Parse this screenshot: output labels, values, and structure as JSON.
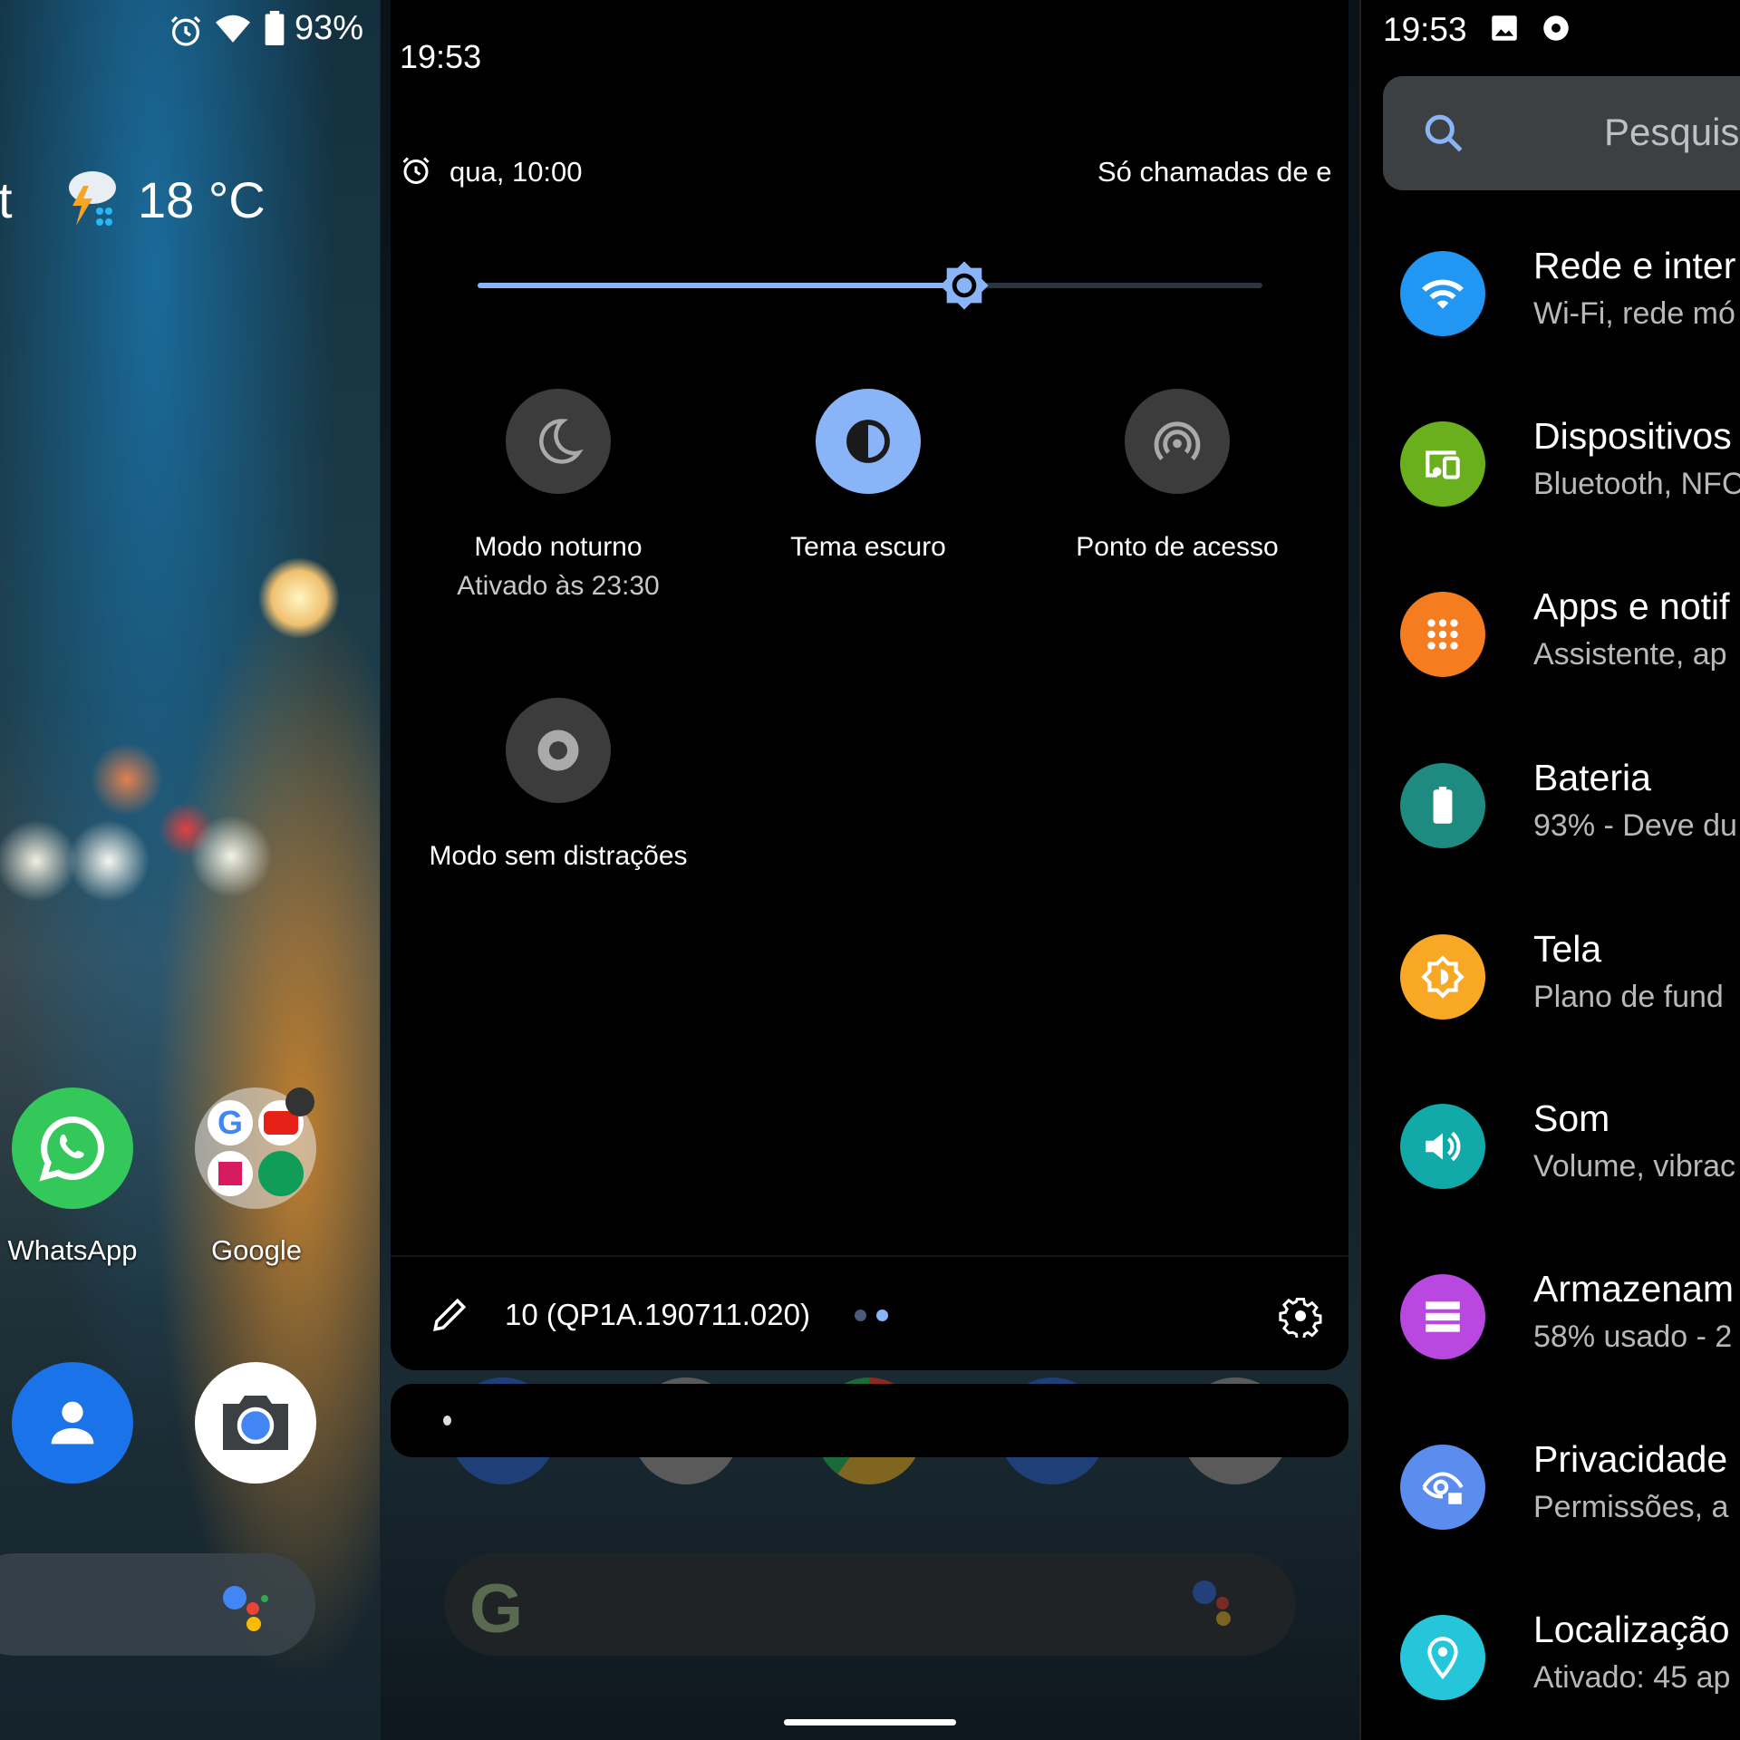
{
  "home": {
    "status": {
      "battery": "93%",
      "icons": [
        "alarm-icon",
        "wifi-icon",
        "battery-icon"
      ]
    },
    "glance_partial": "t",
    "weather": {
      "temp": "18 °C",
      "icon": "thunderstorm-rain-icon"
    },
    "apps": [
      {
        "label": "WhatsApp",
        "icon": "whatsapp-icon"
      },
      {
        "label": "Google",
        "icon": "google-folder-icon"
      }
    ],
    "dock": [
      {
        "icon": "contacts-icon"
      },
      {
        "icon": "camera-icon"
      }
    ]
  },
  "quick_settings": {
    "time": "19:53",
    "alarm": "qua, 10:00",
    "dnd_status": "Só chamadas de er",
    "brightness_percent": 62,
    "tiles": [
      {
        "label": "Modo noturno",
        "sublabel": "Ativado às 23:30",
        "icon": "moon-icon",
        "active": false
      },
      {
        "label": "Tema escuro",
        "icon": "dark-theme-icon",
        "active": true
      },
      {
        "label": "Ponto de acesso",
        "icon": "hotspot-icon",
        "active": false
      },
      {
        "label": "Modo sem distrações",
        "icon": "focus-mode-icon",
        "active": false
      }
    ],
    "build": "10 (QP1A.190711.020)",
    "page": 2,
    "pages": 2,
    "accent": "#8ab4f8"
  },
  "settings": {
    "time": "19:53",
    "search_placeholder": "Pesquisa",
    "items": [
      {
        "title": "Rede e inter",
        "sub": "Wi-Fi, rede mó",
        "color": "#2196f3",
        "icon": "wifi-icon"
      },
      {
        "title": "Dispositivos",
        "sub": "Bluetooth, NFC",
        "color": "#6aaf1e",
        "icon": "devices-icon"
      },
      {
        "title": "Apps e notif",
        "sub": "Assistente, ap",
        "color": "#f57c1f",
        "icon": "apps-grid-icon"
      },
      {
        "title": "Bateria",
        "sub": "93% - Deve du",
        "color": "#1f8a7f",
        "icon": "battery-icon"
      },
      {
        "title": "Tela",
        "sub": "Plano de fund",
        "color": "#f9a825",
        "icon": "brightness-icon"
      },
      {
        "title": "Som",
        "sub": "Volume, vibrac",
        "color": "#12a9a9",
        "icon": "volume-icon"
      },
      {
        "title": "Armazenam",
        "sub": "58% usado - 2",
        "color": "#b848e0",
        "icon": "storage-icon"
      },
      {
        "title": "Privacidade",
        "sub": "Permissões, a",
        "color": "#5b8def",
        "icon": "privacy-icon"
      },
      {
        "title": "Localização",
        "sub": "Ativado: 45 ap",
        "color": "#26c6da",
        "icon": "location-icon"
      }
    ]
  }
}
